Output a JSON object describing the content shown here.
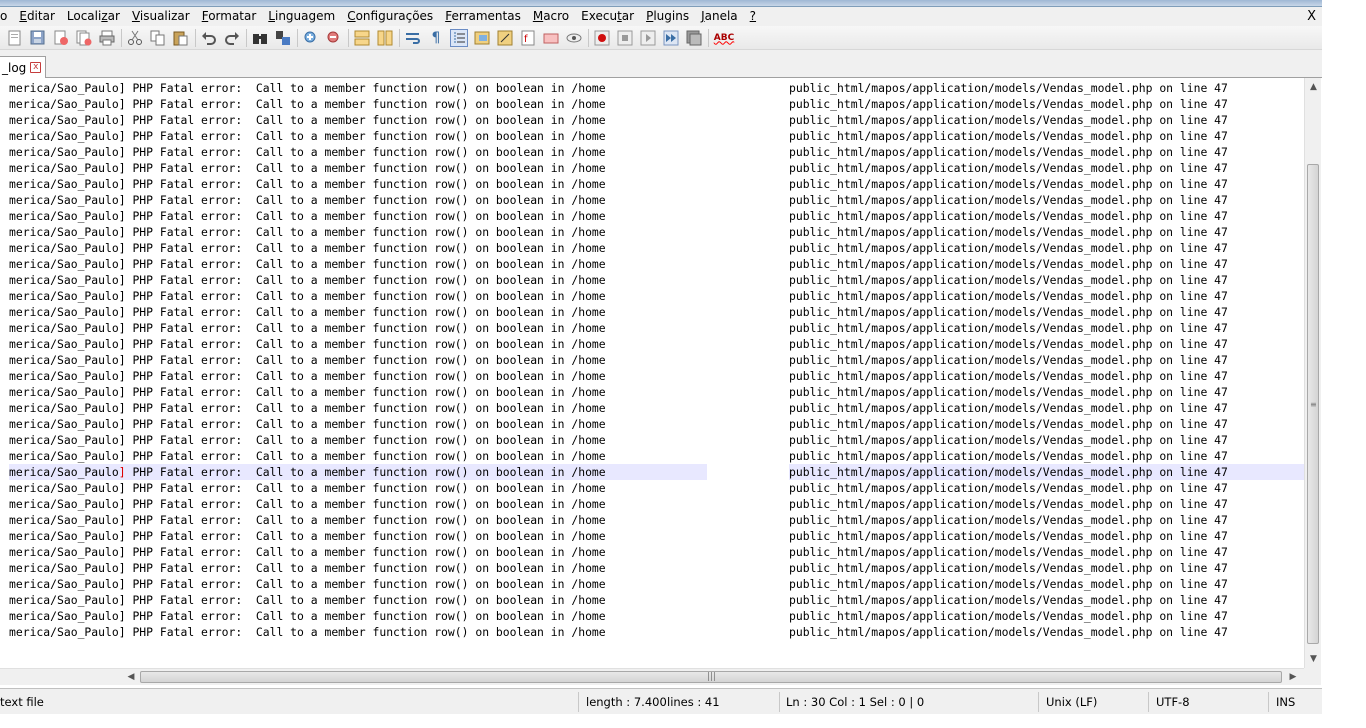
{
  "menu": {
    "items": [
      {
        "label": "o"
      },
      {
        "label": "Editar"
      },
      {
        "label": "Localizar"
      },
      {
        "label": "Visualizar"
      },
      {
        "label": "Formatar"
      },
      {
        "label": "Linguagem"
      },
      {
        "label": "Configurações"
      },
      {
        "label": "Ferramentas"
      },
      {
        "label": "Macro"
      },
      {
        "label": "Executar"
      },
      {
        "label": "Plugins"
      },
      {
        "label": "Janela"
      },
      {
        "label": "?"
      }
    ],
    "close_label": "X"
  },
  "toolbar": {
    "icons": [
      "new-file-icon",
      "save-all-icon",
      "close-icon",
      "close-all-icon",
      "print-icon",
      "cut-icon",
      "copy-icon",
      "paste-icon",
      "undo-icon",
      "redo-icon",
      "find-icon",
      "replace-icon",
      "zoom-in-icon",
      "zoom-out-icon",
      "sync-vertical-icon",
      "sync-horizontal-icon",
      "word-wrap-icon",
      "show-all-chars-icon",
      "indent-guide-icon",
      "doc-map-icon",
      "function-list-icon",
      "folder-workspace-icon",
      "monitor-icon",
      "record-macro-icon",
      "stop-record-icon",
      "play-macro-icon",
      "run-multiple-icon",
      "save-macro-icon",
      "spell-check-icon"
    ],
    "spellcheck_label": "ABC"
  },
  "tab": {
    "label": "_log",
    "close_glyph": "x"
  },
  "editor": {
    "line_prefix": "merica/Sao_Paulo",
    "line_bracket": "]",
    "line_middle": " PHP Fatal error:  Call to a member function row() on boolean in /home",
    "line_suffix": "public_html/mapos/application/models/Vendas_model.php on line 47",
    "visible_line_count": 35,
    "current_line_index": 24
  },
  "statusbar": {
    "file_type": "text file",
    "length": "length : 7.400",
    "lines": "lines : 41",
    "position": "Ln : 30    Col : 1    Sel : 0 | 0",
    "eol": "Unix (LF)",
    "encoding": "UTF-8",
    "mode": "INS"
  }
}
